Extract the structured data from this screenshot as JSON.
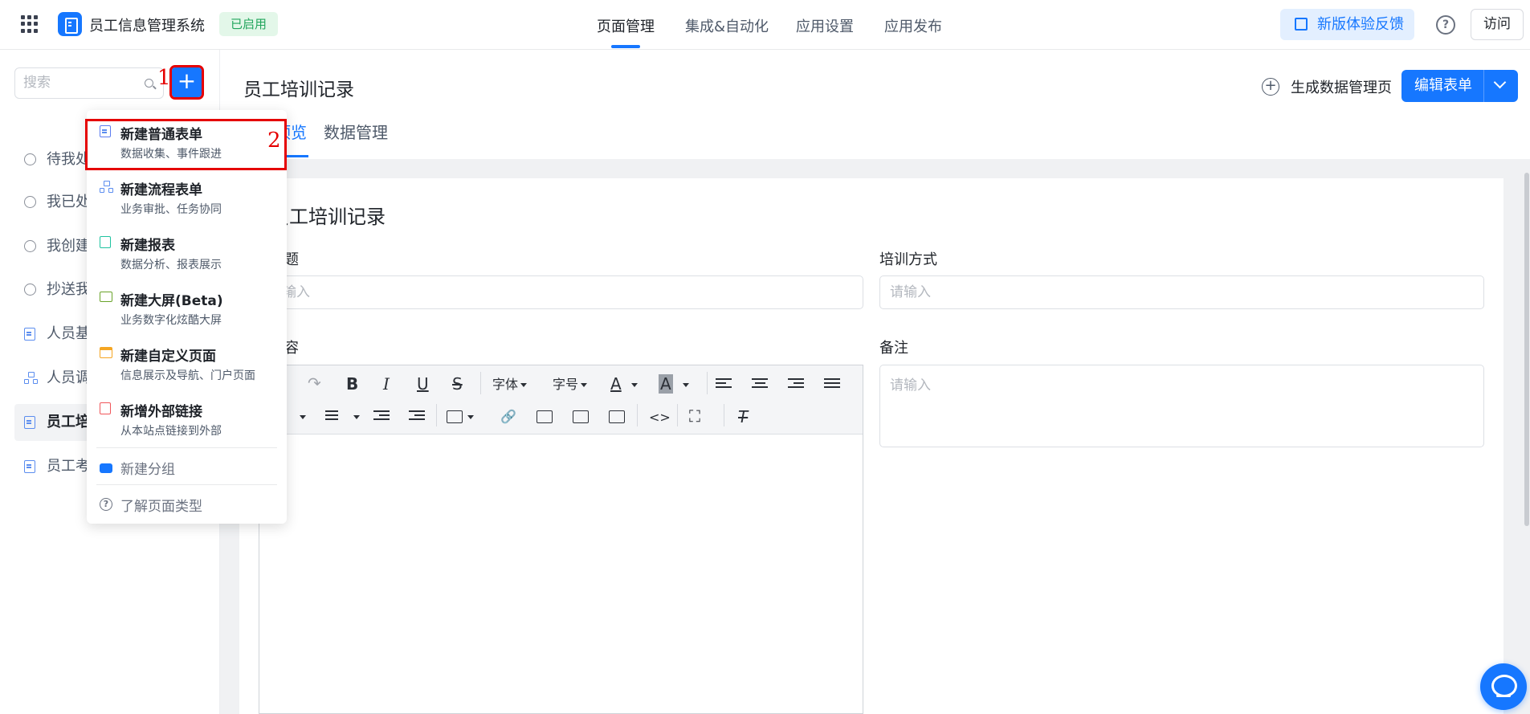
{
  "header": {
    "app_name": "员工信息管理系统",
    "status": "已启用",
    "nav": [
      "页面管理",
      "集成&自动化",
      "应用设置",
      "应用发布"
    ],
    "feedback": "新版体验反馈",
    "visit": "访问"
  },
  "sidebar": {
    "search_placeholder": "搜索",
    "items": [
      "待我处理",
      "我已处理",
      "我创建的",
      "抄送我的",
      "人员基础信息",
      "人员调动",
      "员工培训记录",
      "员工考勤"
    ]
  },
  "annotations": {
    "one": "1",
    "two": "2"
  },
  "menu": {
    "items": [
      {
        "title": "新建普通表单",
        "desc": "数据收集、事件跟进",
        "icon": "form-icon",
        "color": "#5b7cf0"
      },
      {
        "title": "新建流程表单",
        "desc": "业务审批、任务协同",
        "icon": "flow-icon",
        "color": "#2f8cf5"
      },
      {
        "title": "新建报表",
        "desc": "数据分析、报表展示",
        "icon": "report-icon",
        "color": "#1fc3a0"
      },
      {
        "title": "新建大屏(Beta)",
        "desc": "业务数字化炫酷大屏",
        "icon": "screen-icon",
        "color": "#6aa32a"
      },
      {
        "title": "新建自定义页面",
        "desc": "信息展示及导航、门户页面",
        "icon": "custom-page-icon",
        "color": "#f5a623"
      },
      {
        "title": "新增外部链接",
        "desc": "从本站点链接到外部",
        "icon": "link-icon",
        "color": "#f0565a"
      }
    ],
    "group": "新建分组",
    "learn": "了解页面类型"
  },
  "main": {
    "title": "员工培训记录",
    "generate": "生成数据管理页",
    "edit": "编辑表单",
    "tabs": [
      "预览",
      "数据管理"
    ],
    "form_title": "员工培训记录",
    "fields": {
      "title_label": "标题",
      "method_label": "培训方式",
      "content_label": "内容",
      "remark_label": "备注",
      "placeholder": "请输入"
    },
    "toolbar": {
      "font": "字体",
      "size": "字号",
      "bold": "B",
      "italic": "I",
      "underline": "U",
      "strike": "S",
      "color": "A",
      "bg": "A",
      "code": "<>",
      "clear": "T"
    }
  }
}
